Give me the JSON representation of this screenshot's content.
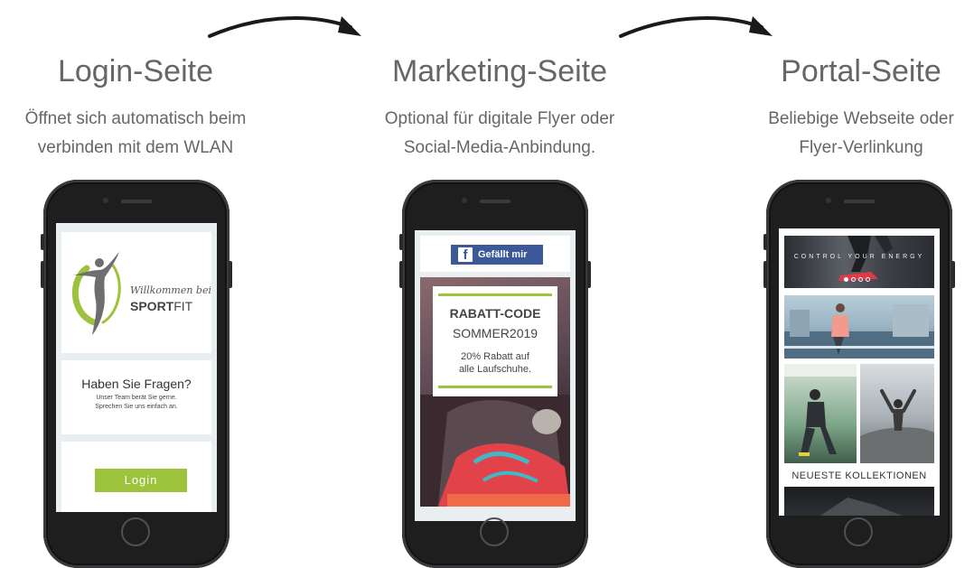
{
  "columns": [
    {
      "title": "Login-Seite",
      "description_lines": [
        "Öffnet sich automatisch beim",
        "verbinden mit dem WLAN"
      ]
    },
    {
      "title": "Marketing-Seite",
      "description_lines": [
        "Optional für digitale Flyer oder",
        "Social-Media-Anbindung."
      ]
    },
    {
      "title": "Portal-Seite",
      "description_lines": [
        "Beliebige Webseite oder",
        "Flyer-Verlinkung"
      ]
    }
  ],
  "login_screen": {
    "welcome_text": "Willkommen bei",
    "brand_bold": "SPORT",
    "brand_light": "FIT",
    "faq_title": "Haben Sie Fragen?",
    "faq_lines": [
      "Unser Team berät Sie gerne.",
      "Sprechen Sie uns einfach an."
    ],
    "login_button": "Login"
  },
  "marketing_screen": {
    "like_button": "Gefällt mir",
    "like_icon_letter": "f",
    "promo_title": "RABATT-CODE",
    "promo_code": "SOMMER2019",
    "promo_text_lines": [
      "20% Rabatt auf",
      "alle Laufschuhe."
    ]
  },
  "portal_screen": {
    "banner_text": "CONTROL YOUR ENERGY",
    "section_label": "NEUESTE KOLLEKTIONEN"
  },
  "colors": {
    "accent_green": "#9dc23b",
    "facebook_blue": "#3b5998",
    "phone_body": "#1e1e1f",
    "screen_bg": "#e9eef1"
  }
}
